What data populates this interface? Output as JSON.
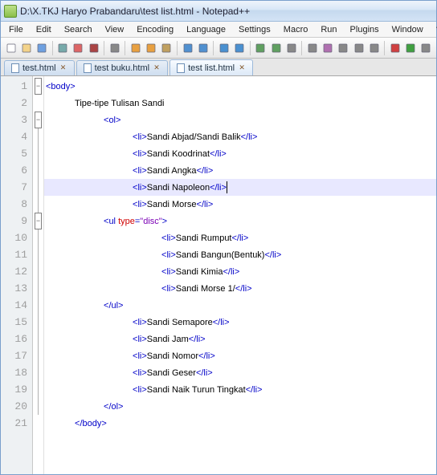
{
  "title": "D:\\X.TKJ Haryo Prabandaru\\test list.html - Notepad++",
  "menus": [
    "File",
    "Edit",
    "Search",
    "View",
    "Encoding",
    "Language",
    "Settings",
    "Macro",
    "Run",
    "Plugins",
    "Window",
    "?"
  ],
  "tabs": [
    {
      "label": "test.html",
      "active": false
    },
    {
      "label": "test buku.html",
      "active": false
    },
    {
      "label": "test list.html",
      "active": true
    }
  ],
  "lines": [
    {
      "n": 1,
      "fold": "box",
      "hl": false,
      "ind": 0,
      "seg": [
        [
          "t",
          "<body>"
        ]
      ]
    },
    {
      "n": 2,
      "fold": "",
      "hl": false,
      "ind": 1,
      "seg": [
        [
          "x",
          "Tipe-tipe Tulisan Sandi"
        ]
      ]
    },
    {
      "n": 3,
      "fold": "box",
      "hl": false,
      "ind": 2,
      "seg": [
        [
          "t",
          "<ol>"
        ]
      ]
    },
    {
      "n": 4,
      "fold": "line",
      "hl": false,
      "ind": 3,
      "seg": [
        [
          "t",
          "<li>"
        ],
        [
          "x",
          "Sandi Abjad/Sandi Balik"
        ],
        [
          "t",
          "</li>"
        ]
      ]
    },
    {
      "n": 5,
      "fold": "line",
      "hl": false,
      "ind": 3,
      "seg": [
        [
          "t",
          "<li>"
        ],
        [
          "x",
          "Sandi Koodrinat"
        ],
        [
          "t",
          "</li>"
        ]
      ]
    },
    {
      "n": 6,
      "fold": "line",
      "hl": false,
      "ind": 3,
      "seg": [
        [
          "t",
          "<li>"
        ],
        [
          "x",
          "Sandi Angka"
        ],
        [
          "t",
          "</li>"
        ]
      ]
    },
    {
      "n": 7,
      "fold": "line",
      "hl": true,
      "ind": 3,
      "seg": [
        [
          "t",
          "<li>"
        ],
        [
          "x",
          "Sandi Napoleon"
        ],
        [
          "t",
          "</li>"
        ]
      ],
      "cursor": true
    },
    {
      "n": 8,
      "fold": "line",
      "hl": false,
      "ind": 3,
      "seg": [
        [
          "t",
          "<li>"
        ],
        [
          "x",
          "Sandi Morse"
        ],
        [
          "t",
          "</li>"
        ]
      ]
    },
    {
      "n": 9,
      "fold": "box",
      "hl": false,
      "ind": 2,
      "seg": [
        [
          "t",
          "<ul "
        ],
        [
          "a",
          "type"
        ],
        [
          "t",
          "="
        ],
        [
          "v",
          "\"disc\""
        ],
        [
          "t",
          ">"
        ]
      ]
    },
    {
      "n": 10,
      "fold": "line",
      "hl": false,
      "ind": 4,
      "seg": [
        [
          "t",
          "<li>"
        ],
        [
          "x",
          "Sandi Rumput"
        ],
        [
          "t",
          "</li>"
        ]
      ]
    },
    {
      "n": 11,
      "fold": "line",
      "hl": false,
      "ind": 4,
      "seg": [
        [
          "t",
          "<li>"
        ],
        [
          "x",
          "Sandi Bangun(Bentuk)"
        ],
        [
          "t",
          "</li>"
        ]
      ]
    },
    {
      "n": 12,
      "fold": "line",
      "hl": false,
      "ind": 4,
      "seg": [
        [
          "t",
          "<li>"
        ],
        [
          "x",
          "Sandi Kimia"
        ],
        [
          "t",
          "</li>"
        ]
      ]
    },
    {
      "n": 13,
      "fold": "line",
      "hl": false,
      "ind": 4,
      "seg": [
        [
          "t",
          "<li>"
        ],
        [
          "x",
          "Sandi Morse 1/"
        ],
        [
          "t",
          "</li>"
        ]
      ]
    },
    {
      "n": 14,
      "fold": "line",
      "hl": false,
      "ind": 2,
      "seg": [
        [
          "t",
          "</ul>"
        ]
      ]
    },
    {
      "n": 15,
      "fold": "line",
      "hl": false,
      "ind": 3,
      "seg": [
        [
          "t",
          "<li>"
        ],
        [
          "x",
          "Sandi Semapore"
        ],
        [
          "t",
          "</li>"
        ]
      ]
    },
    {
      "n": 16,
      "fold": "line",
      "hl": false,
      "ind": 3,
      "seg": [
        [
          "t",
          "<li>"
        ],
        [
          "x",
          "Sandi Jam"
        ],
        [
          "t",
          "</li>"
        ]
      ]
    },
    {
      "n": 17,
      "fold": "line",
      "hl": false,
      "ind": 3,
      "seg": [
        [
          "t",
          "<li>"
        ],
        [
          "x",
          "Sandi Nomor"
        ],
        [
          "t",
          "</li>"
        ]
      ]
    },
    {
      "n": 18,
      "fold": "line",
      "hl": false,
      "ind": 3,
      "seg": [
        [
          "t",
          "<li>"
        ],
        [
          "x",
          "Sandi Geser"
        ],
        [
          "t",
          "</li>"
        ]
      ]
    },
    {
      "n": 19,
      "fold": "line",
      "hl": false,
      "ind": 3,
      "seg": [
        [
          "t",
          "<li>"
        ],
        [
          "x",
          "Sandi Naik Turun Tingkat"
        ],
        [
          "t",
          "</li>"
        ]
      ]
    },
    {
      "n": 20,
      "fold": "line",
      "hl": false,
      "ind": 2,
      "seg": [
        [
          "t",
          "</ol>"
        ]
      ]
    },
    {
      "n": 21,
      "fold": "",
      "hl": false,
      "ind": 1,
      "seg": [
        [
          "t",
          "</body>"
        ]
      ]
    }
  ],
  "toolbar_icons": [
    "new",
    "open",
    "save",
    "save-all",
    "close",
    "close-all",
    "print",
    "cut",
    "copy",
    "paste",
    "undo",
    "redo",
    "find",
    "replace",
    "zoom-in",
    "zoom-out",
    "sync",
    "wrap",
    "show-all",
    "indent",
    "fold",
    "unfold",
    "record",
    "play",
    "macro"
  ]
}
